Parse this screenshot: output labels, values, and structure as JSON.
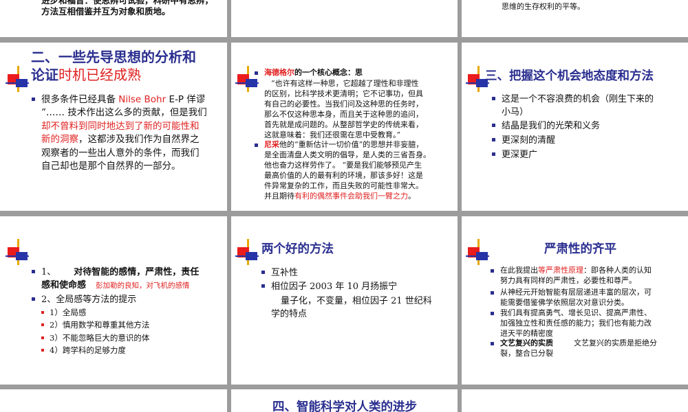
{
  "s1": {
    "line1": "进步和福音：使思辨可试验，科研中有思辨，",
    "line2": "方法互相借鉴并互为对象和质地。"
  },
  "s3": {
    "line1": "思维的生存权利的平等。"
  },
  "s4": {
    "title_line1": "二、一些先导思想的分析和",
    "title_line2a": "论证",
    "title_line2b": "时机已经成熟",
    "b1_text": "很多条件已经具备 ",
    "b1_red": "Nilse Bohr",
    "b1_tail": " E-P  佯谬",
    "p1": "“…… 技术作出这么多的贡献，但是我们",
    "p2_red": "却不曾料到同时地达到了新的可能性和",
    "p3_red": "新的洞察",
    "p3_tail": "，这都涉及我们作为自然界之",
    "p4": "观察者的一些出人意外的条件，而我们",
    "p5": "自己却也是那个自然界的一部分。"
  },
  "s5": {
    "h_red": "海德格尔",
    "h_tail": "的一个核心概念：思",
    "q1": "“也许有这样一种思，它超越了理性和非理性",
    "q2": "的区别，比科学技术更清明；它不记事功，但具",
    "q3": "有自己的必要性。当我们问及这种思的任务时，",
    "q4": "那么不仅这种思本身，而且关于这种思的追问，",
    "q5": "首先就是成问题的。从整部哲学史的传统来看，",
    "q6": "这就意味着：我们还很需在思中受教育。”",
    "n_red": "尼采",
    "n1": "他的“重新估计一切价值”的思想并非妄臆，",
    "n2": "是全面清盘人类文明的倡导，是人类的三省吾身。",
    "n3": "他也奋力这样劳作了。 “要是我们能够预见产生",
    "n4": "最高价值的人的最有利的环境，那该多好！这是",
    "n5": "件异常复杂的工作，而且失败的可能性非常大。",
    "n6a": "并且期待",
    "n6_red": "有利的偶然事件会助我们一臂之力",
    "n6b": "。"
  },
  "s6": {
    "title": "三、把握这个机会地态度和方法",
    "b1a": "这是一个不容浪费的机会（刚生下来的",
    "b1b": "小马）",
    "b2": "结晶是我们的光荣和义务",
    "b3": "更深刻的清醒",
    "b4": "更深更广"
  },
  "s7": {
    "b1_num": "1、",
    "b1_bold": "对待智能的感情，严肃性，责任",
    "b1_bold2": "感和使命感",
    "b1_red": "彭加勒的良知，对飞机的感情",
    "b2": "2、全局感等方法的提示",
    "sub1": "1）全局感",
    "sub2": "2）慎用数学和尊重其他方法",
    "sub3": "3）不能忽略巨大的意识的体",
    "sub4": "4）跨学科的足够力度"
  },
  "s8": {
    "title": "两个好的方法",
    "b1": "互补性",
    "b2": "相位因子 2003 年 10 月扬振宁",
    "p1": "量子化，不变量，相位因子 21 世纪科",
    "p2": "学的特点"
  },
  "s9": {
    "title": "严肃性的齐平",
    "b1a": "在此我提出",
    "b1_red": "等严肃性原理",
    "b1b": "：即各种人类的认知",
    "b1c": "努力具有同样的严肃性，必要性和尊严。",
    "b2a": "从神经元开始智能有层层递进丰富的层次，可",
    "b2b": "能需要借鉴佛学依照层次对意识分类。",
    "b3a": "我们具有提高勇气、增长见识、提高严肃性、",
    "b3b": "加强独立性和责任感的能力；我们也有能力改",
    "b3c": "进天平的精密度",
    "b4_bold": "文艺复兴的实质",
    "b4_tail": "文艺复兴的实质是拒绝分",
    "b4c": "裂，整合已分裂"
  },
  "s11": {
    "title": "四、智能科学对人类的进步"
  }
}
